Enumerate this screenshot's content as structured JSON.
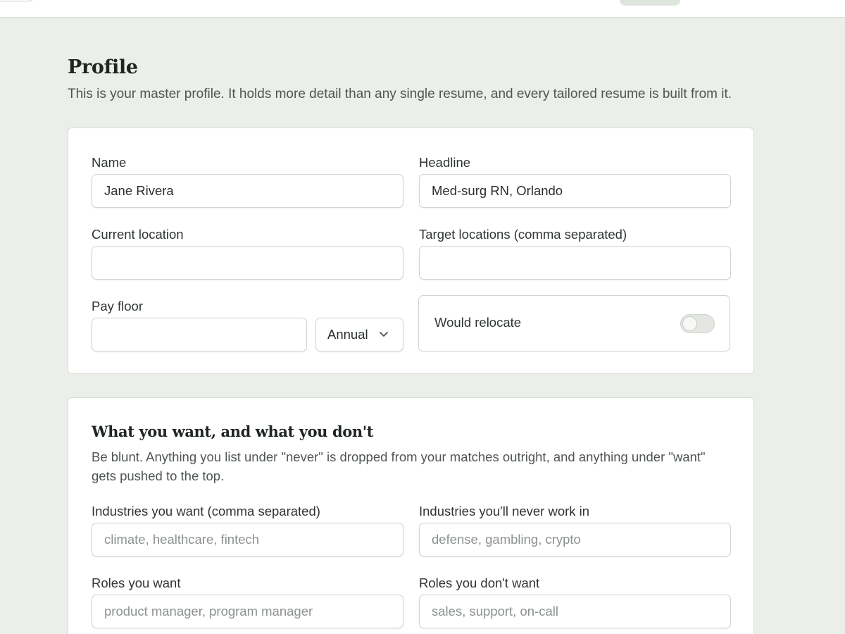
{
  "page": {
    "title": "Profile",
    "subtitle": "This is your master profile. It holds more detail than any single resume, and every tailored resume is built from it."
  },
  "basics": {
    "name_label": "Name",
    "name_value": "Jane Rivera",
    "headline_label": "Headline",
    "headline_value": "Med-surg RN, Orlando",
    "current_location_label": "Current location",
    "current_location_value": "",
    "target_locations_label": "Target locations (comma separated)",
    "target_locations_value": "",
    "pay_floor_label": "Pay floor",
    "pay_floor_value": "",
    "pay_period_selected": "Annual",
    "relocate_label": "Would relocate",
    "relocate_on": false
  },
  "preferences": {
    "title": "What you want, and what you don't",
    "description": "Be blunt. Anything you list under \"never\" is dropped from your matches outright, and anything under \"want\" gets pushed to the top.",
    "industries_want_label": "Industries you want (comma separated)",
    "industries_want_placeholder": "climate, healthcare, fintech",
    "industries_never_label": "Industries you'll never work in",
    "industries_never_placeholder": "defense, gambling, crypto",
    "roles_want_label": "Roles you want",
    "roles_want_placeholder": "product manager, program manager",
    "roles_dont_want_label": "Roles you don't want",
    "roles_dont_want_placeholder": "sales, support, on-call"
  },
  "icons": {
    "select_chevron": "chevron-down-icon"
  }
}
